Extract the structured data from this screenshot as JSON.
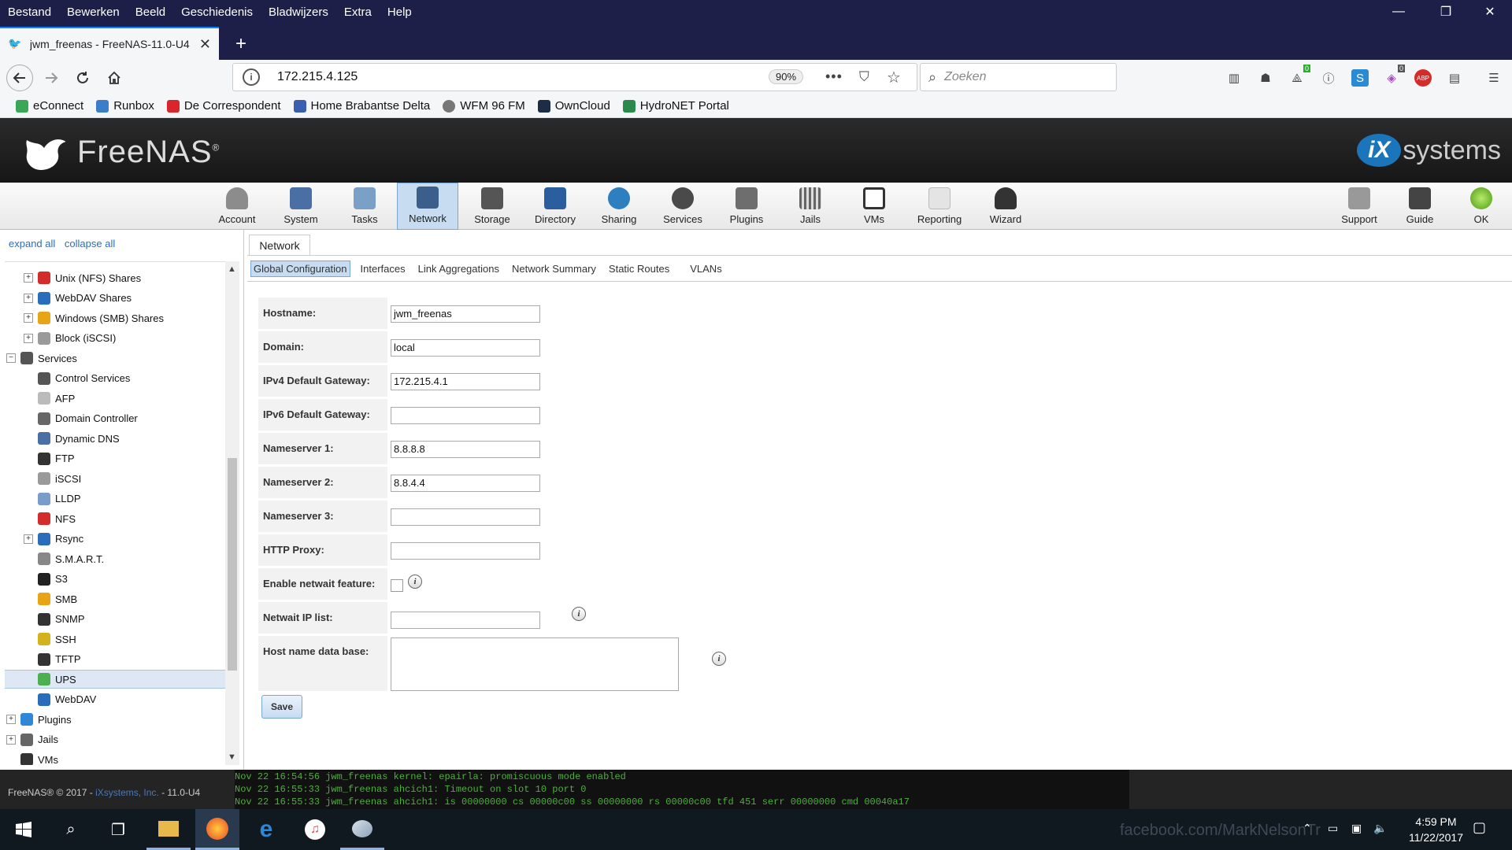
{
  "menubar": {
    "items": [
      "Bestand",
      "Bewerken",
      "Beeld",
      "Geschiedenis",
      "Bladwijzers",
      "Extra",
      "Help"
    ],
    "minimize": "—",
    "restore": "❐",
    "close": "✕"
  },
  "tab": {
    "title": "jwm_freenas - FreeNAS-11.0-U4",
    "close": "✕",
    "new_tab": "+"
  },
  "nav": {
    "url": "172.215.4.125",
    "zoom": "90%",
    "search_placeholder": "Zoeken",
    "more": "•••",
    "badge_green": "0",
    "badge_purple": "0",
    "abp": "ABP"
  },
  "bookmarks": [
    {
      "label": "eConnect",
      "color": "#3aa657"
    },
    {
      "label": "Runbox",
      "color": "#3a7ec9"
    },
    {
      "label": "De Correspondent",
      "color": "#d9262c"
    },
    {
      "label": "Home Brabantse Delta",
      "color": "#3a5fb0"
    },
    {
      "label": "WFM 96 FM",
      "color": "#777777"
    },
    {
      "label": "OwnCloud",
      "color": "#1d2d44"
    },
    {
      "label": "HydroNET Portal",
      "color": "#2a8a4e"
    }
  ],
  "header": {
    "logo_text": "FreeNAS",
    "logo_reg": "®",
    "ix_mark": "iX",
    "ix_text": "systems"
  },
  "toolbar": {
    "items": [
      {
        "label": "Account",
        "icon": "account-icon",
        "color": "#8c8c8c"
      },
      {
        "label": "System",
        "icon": "system-icon",
        "color": "#4a6fa5"
      },
      {
        "label": "Tasks",
        "icon": "tasks-icon",
        "color": "#7aa0c8"
      },
      {
        "label": "Network",
        "icon": "network-icon",
        "color": "#3b5f8a"
      },
      {
        "label": "Storage",
        "icon": "storage-icon",
        "color": "#555555"
      },
      {
        "label": "Directory",
        "icon": "directory-icon",
        "color": "#2b5e9e"
      },
      {
        "label": "Sharing",
        "icon": "sharing-icon",
        "color": "#2e7fbf"
      },
      {
        "label": "Services",
        "icon": "services-icon",
        "color": "#4a4a4a"
      },
      {
        "label": "Plugins",
        "icon": "plugins-icon",
        "color": "#6e6e6e"
      },
      {
        "label": "Jails",
        "icon": "jails-icon",
        "color": "#666666"
      },
      {
        "label": "VMs",
        "icon": "vms-icon",
        "color": "#333333"
      },
      {
        "label": "Reporting",
        "icon": "reporting-icon",
        "color": "#cccccc"
      },
      {
        "label": "Wizard",
        "icon": "wizard-icon",
        "color": "#333333"
      }
    ],
    "right": [
      {
        "label": "Support",
        "icon": "support-icon",
        "color": "#999999"
      },
      {
        "label": "Guide",
        "icon": "guide-icon",
        "color": "#444444"
      },
      {
        "label": "OK",
        "icon": "ok-icon",
        "color": "#6cc02a"
      }
    ],
    "active": "Network"
  },
  "tree": {
    "expand_all": "expand all",
    "collapse_all": "collapse all",
    "nodes": [
      {
        "label": "Unix (NFS) Shares",
        "pm": "+",
        "color": "#d42b2b",
        "indent": 1
      },
      {
        "label": "WebDAV Shares",
        "pm": "+",
        "color": "#2a6ebb",
        "indent": 1
      },
      {
        "label": "Windows (SMB) Shares",
        "pm": "+",
        "color": "#e8a417",
        "indent": 1
      },
      {
        "label": "Block (iSCSI)",
        "pm": "+",
        "color": "#9a9a9a",
        "indent": 1
      },
      {
        "label": "Services",
        "pm": "−",
        "color": "#555555",
        "indent": 0
      },
      {
        "label": "Control Services",
        "pm": "",
        "color": "#555555",
        "indent": 1
      },
      {
        "label": "AFP",
        "pm": "",
        "color": "#bbbbbb",
        "indent": 1
      },
      {
        "label": "Domain Controller",
        "pm": "",
        "color": "#666666",
        "indent": 1
      },
      {
        "label": "Dynamic DNS",
        "pm": "",
        "color": "#4a6fa5",
        "indent": 1
      },
      {
        "label": "FTP",
        "pm": "",
        "color": "#333333",
        "indent": 1
      },
      {
        "label": "iSCSI",
        "pm": "",
        "color": "#9a9a9a",
        "indent": 1
      },
      {
        "label": "LLDP",
        "pm": "",
        "color": "#7a9cc8",
        "indent": 1
      },
      {
        "label": "NFS",
        "pm": "",
        "color": "#d42b2b",
        "indent": 1
      },
      {
        "label": "Rsync",
        "pm": "+",
        "color": "#2a6ebb",
        "indent": 1
      },
      {
        "label": "S.M.A.R.T.",
        "pm": "",
        "color": "#888888",
        "indent": 1
      },
      {
        "label": "S3",
        "pm": "",
        "color": "#222222",
        "indent": 1
      },
      {
        "label": "SMB",
        "pm": "",
        "color": "#e8a417",
        "indent": 1
      },
      {
        "label": "SNMP",
        "pm": "",
        "color": "#333333",
        "indent": 1
      },
      {
        "label": "SSH",
        "pm": "",
        "color": "#d4b21c",
        "indent": 1
      },
      {
        "label": "TFTP",
        "pm": "",
        "color": "#333333",
        "indent": 1
      },
      {
        "label": "UPS",
        "pm": "",
        "color": "#4caf50",
        "indent": 1,
        "selected": true
      },
      {
        "label": "WebDAV",
        "pm": "",
        "color": "#2a6ebb",
        "indent": 1
      },
      {
        "label": "Plugins",
        "pm": "+",
        "color": "#2e88d6",
        "indent": 0
      },
      {
        "label": "Jails",
        "pm": "+",
        "color": "#666666",
        "indent": 0
      },
      {
        "label": "VMs",
        "pm": "",
        "color": "#333333",
        "indent": 0
      }
    ]
  },
  "content": {
    "tab": "Network",
    "subtabs": [
      "Global Configuration",
      "Interfaces",
      "Link Aggregations",
      "Network Summary",
      "Static Routes",
      "VLANs"
    ],
    "active_subtab": "Global Configuration",
    "fields": {
      "hostname": {
        "label": "Hostname:",
        "value": "jwm_freenas"
      },
      "domain": {
        "label": "Domain:",
        "value": "local"
      },
      "ipv4_gw": {
        "label": "IPv4 Default Gateway:",
        "value": "172.215.4.1"
      },
      "ipv6_gw": {
        "label": "IPv6 Default Gateway:",
        "value": ""
      },
      "ns1": {
        "label": "Nameserver 1:",
        "value": "8.8.8.8"
      },
      "ns2": {
        "label": "Nameserver 2:",
        "value": "8.8.4.4"
      },
      "ns3": {
        "label": "Nameserver 3:",
        "value": ""
      },
      "proxy": {
        "label": "HTTP Proxy:",
        "value": ""
      },
      "netwait": {
        "label": "Enable netwait feature:",
        "checked": false
      },
      "netwait_ips": {
        "label": "Netwait IP list:",
        "value": ""
      },
      "hosts": {
        "label": "Host name data base:",
        "value": ""
      }
    },
    "info_glyph": "i",
    "save_label": "Save"
  },
  "footer": {
    "copyright": "FreeNAS® © 2017 - ",
    "company": "iXsystems, Inc.",
    "version": " - 11.0-U4",
    "console": [
      "Nov 22 16:54:56 jwm_freenas kernel: epairla: promiscuous mode enabled",
      "Nov 22 16:55:33 jwm_freenas ahcich1: Timeout on slot 10 port 0",
      "Nov 22 16:55:33 jwm_freenas ahcich1: is 00000000 cs 00000c00 ss 00000000 rs 00000c00 tfd 451 serr 00000000 cmd 00040a17"
    ]
  },
  "taskbar": {
    "time": "4:59 PM",
    "date": "11/22/2017",
    "watermark": "facebook.com/MarkNelsonTr"
  }
}
